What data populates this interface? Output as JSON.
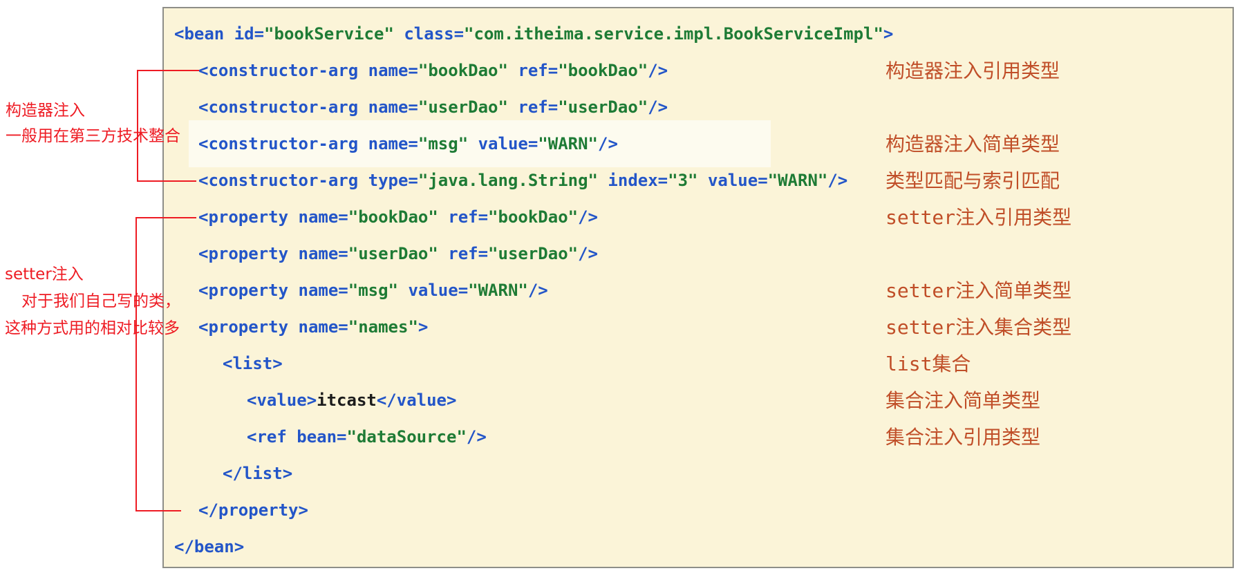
{
  "colors": {
    "panel-bg": "#FBF4D8",
    "panel-border": "#8E8E88",
    "highlight-bg": "#FDFBEF",
    "code-blue": "#2355C8",
    "code-green": "#1E7B35",
    "code-black": "#1C1C1C",
    "note-red": "#EE1B23",
    "note-brick": "#C04E28"
  },
  "code": {
    "language": "spring-xml",
    "highlighted_line": 4,
    "lines": [
      {
        "indent": 0,
        "tokens": [
          {
            "c": "b",
            "t": "<bean id="
          },
          {
            "c": "g",
            "t": "\"bookService\""
          },
          {
            "c": "b",
            "t": " class="
          },
          {
            "c": "g",
            "t": "\"com.itheima.service.impl.BookServiceImpl\""
          },
          {
            "c": "b",
            "t": ">"
          }
        ]
      },
      {
        "indent": 1,
        "tokens": [
          {
            "c": "b",
            "t": "<constructor-arg name="
          },
          {
            "c": "g",
            "t": "\"bookDao\""
          },
          {
            "c": "b",
            "t": " ref="
          },
          {
            "c": "g",
            "t": "\"bookDao\""
          },
          {
            "c": "b",
            "t": "/>"
          }
        ]
      },
      {
        "indent": 1,
        "tokens": [
          {
            "c": "b",
            "t": "<constructor-arg name="
          },
          {
            "c": "g",
            "t": "\"userDao\""
          },
          {
            "c": "b",
            "t": " ref="
          },
          {
            "c": "g",
            "t": "\"userDao\""
          },
          {
            "c": "b",
            "t": "/>"
          }
        ]
      },
      {
        "indent": 1,
        "tokens": [
          {
            "c": "b",
            "t": "<constructor-arg name="
          },
          {
            "c": "g",
            "t": "\"msg\""
          },
          {
            "c": "b",
            "t": " value="
          },
          {
            "c": "g",
            "t": "\"WARN\""
          },
          {
            "c": "b",
            "t": "/>"
          }
        ]
      },
      {
        "indent": 1,
        "tokens": [
          {
            "c": "b",
            "t": "<constructor-arg type="
          },
          {
            "c": "g",
            "t": "\"java.lang.String\""
          },
          {
            "c": "b",
            "t": " index="
          },
          {
            "c": "g",
            "t": "\"3\""
          },
          {
            "c": "b",
            "t": " value="
          },
          {
            "c": "g",
            "t": "\"WARN\""
          },
          {
            "c": "b",
            "t": "/>"
          }
        ]
      },
      {
        "indent": 1,
        "tokens": [
          {
            "c": "b",
            "t": "<property name="
          },
          {
            "c": "g",
            "t": "\"bookDao\""
          },
          {
            "c": "b",
            "t": " ref="
          },
          {
            "c": "g",
            "t": "\"bookDao\""
          },
          {
            "c": "b",
            "t": "/>"
          }
        ]
      },
      {
        "indent": 1,
        "tokens": [
          {
            "c": "b",
            "t": "<property name="
          },
          {
            "c": "g",
            "t": "\"userDao\""
          },
          {
            "c": "b",
            "t": " ref="
          },
          {
            "c": "g",
            "t": "\"userDao\""
          },
          {
            "c": "b",
            "t": "/>"
          }
        ]
      },
      {
        "indent": 1,
        "tokens": [
          {
            "c": "b",
            "t": "<property name="
          },
          {
            "c": "g",
            "t": "\"msg\""
          },
          {
            "c": "b",
            "t": " value="
          },
          {
            "c": "g",
            "t": "\"WARN\""
          },
          {
            "c": "b",
            "t": "/>"
          }
        ]
      },
      {
        "indent": 1,
        "tokens": [
          {
            "c": "b",
            "t": "<property name="
          },
          {
            "c": "g",
            "t": "\"names\""
          },
          {
            "c": "b",
            "t": ">"
          }
        ]
      },
      {
        "indent": 2,
        "tokens": [
          {
            "c": "b",
            "t": "<list>"
          }
        ]
      },
      {
        "indent": 3,
        "tokens": [
          {
            "c": "b",
            "t": "<value>"
          },
          {
            "c": "k",
            "t": "itcast"
          },
          {
            "c": "b",
            "t": "</value>"
          }
        ]
      },
      {
        "indent": 3,
        "tokens": [
          {
            "c": "b",
            "t": "<ref bean="
          },
          {
            "c": "g",
            "t": "\"dataSource\""
          },
          {
            "c": "b",
            "t": "/>"
          }
        ]
      },
      {
        "indent": 2,
        "tokens": [
          {
            "c": "b",
            "t": "</list>"
          }
        ]
      },
      {
        "indent": 1,
        "tokens": [
          {
            "c": "b",
            "t": "</property>"
          }
        ]
      },
      {
        "indent": 0,
        "tokens": [
          {
            "c": "b",
            "t": "</bean>"
          }
        ]
      }
    ]
  },
  "right_notes": [
    {
      "line": 2,
      "text": "构造器注入引用类型"
    },
    {
      "line": 4,
      "text": "构造器注入简单类型"
    },
    {
      "line": 5,
      "text": "类型匹配与索引匹配"
    },
    {
      "line": 6,
      "text": "setter注入引用类型"
    },
    {
      "line": 8,
      "text": "setter注入简单类型"
    },
    {
      "line": 9,
      "text": "setter注入集合类型"
    },
    {
      "line": 10,
      "text": "list集合"
    },
    {
      "line": 11,
      "text": "集合注入简单类型"
    },
    {
      "line": 12,
      "text": "集合注入引用类型"
    }
  ],
  "left_notes": {
    "constructor": {
      "title": "构造器注入",
      "desc": "一般用在第三方技术整合"
    },
    "setter": {
      "title": "setter注入",
      "desc1": "对于我们自己写的类，",
      "desc2": "这种方式用的相对比较多"
    }
  }
}
